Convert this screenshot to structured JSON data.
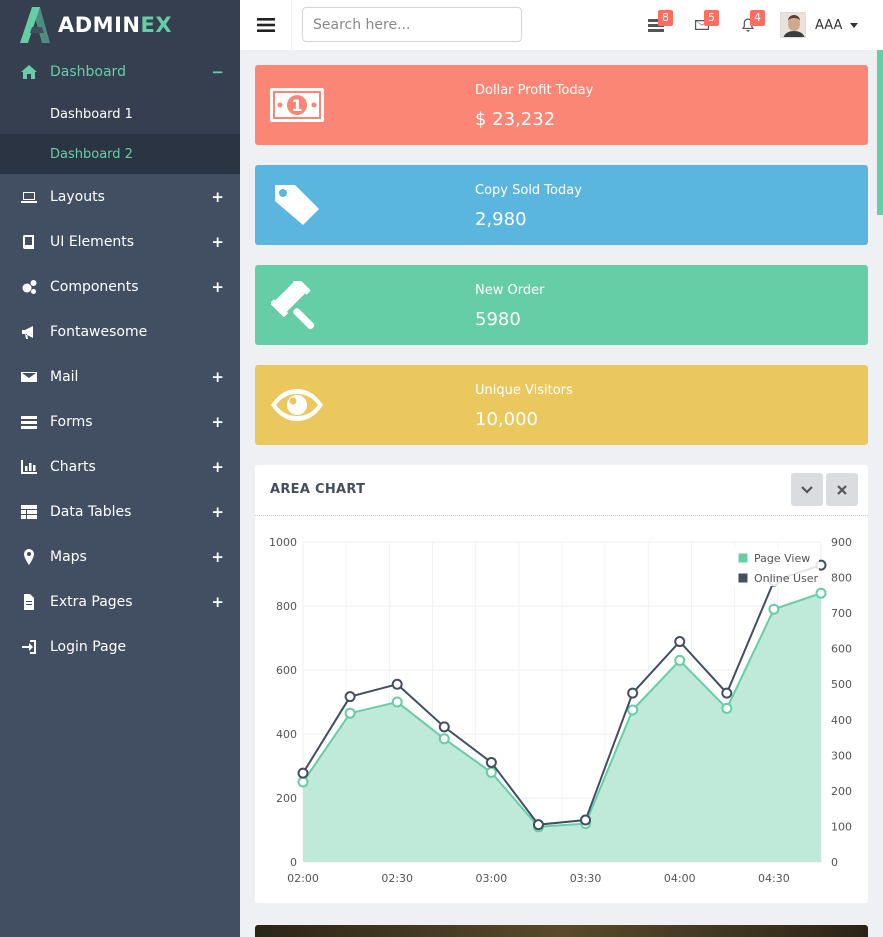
{
  "brand": {
    "text_main": "ADMIN",
    "text_accent": "EX"
  },
  "sidebar": {
    "items": [
      {
        "label": "Dashboard",
        "icon": "home-icon",
        "toggle": "−",
        "active": true,
        "children": [
          {
            "label": "Dashboard 1"
          },
          {
            "label": "Dashboard 2",
            "current": true
          }
        ]
      },
      {
        "label": "Layouts",
        "icon": "laptop-icon",
        "toggle": "+"
      },
      {
        "label": "UI Elements",
        "icon": "book-icon",
        "toggle": "+"
      },
      {
        "label": "Components",
        "icon": "cogs-icon",
        "toggle": "+"
      },
      {
        "label": "Fontawesome",
        "icon": "bullhorn-icon",
        "toggle": ""
      },
      {
        "label": "Mail",
        "icon": "envelope-icon",
        "toggle": "+"
      },
      {
        "label": "Forms",
        "icon": "tasks-icon",
        "toggle": "+"
      },
      {
        "label": "Charts",
        "icon": "bar-chart-icon",
        "toggle": "+"
      },
      {
        "label": "Data Tables",
        "icon": "table-icon",
        "toggle": "+"
      },
      {
        "label": "Maps",
        "icon": "map-marker-icon",
        "toggle": "+"
      },
      {
        "label": "Extra Pages",
        "icon": "file-icon",
        "toggle": "+"
      },
      {
        "label": "Login Page",
        "icon": "sign-in-icon",
        "toggle": ""
      }
    ]
  },
  "header": {
    "search_placeholder": "Search here...",
    "tasks_count": "8",
    "mail_count": "5",
    "notifications_count": "4",
    "user_name": "AAA"
  },
  "stats": [
    {
      "label": "Dollar Profit Today",
      "value": "$ 23,232",
      "color": "#fc8675",
      "icon": "money-icon"
    },
    {
      "label": "Copy Sold Today",
      "value": "2,980",
      "color": "#5ab6df",
      "icon": "tag-icon"
    },
    {
      "label": "New Order",
      "value": "5980",
      "color": "#65cea7",
      "icon": "gavel-icon"
    },
    {
      "label": "Unique Visitors",
      "value": "10,000",
      "color": "#ebc85e",
      "icon": "eye-icon"
    }
  ],
  "panel": {
    "title": "AREA CHART"
  },
  "chart_data": {
    "type": "line",
    "x_ticks": [
      "02:00",
      "02:30",
      "03:00",
      "03:30",
      "04:00",
      "04:30"
    ],
    "x": [
      "02:00",
      "02:15",
      "02:30",
      "02:45",
      "03:00",
      "03:15",
      "03:30",
      "03:45",
      "04:00",
      "04:15",
      "04:30",
      "04:45"
    ],
    "y_left_ticks": [
      "0",
      "200",
      "400",
      "600",
      "800",
      "1000"
    ],
    "y_right_ticks": [
      "0",
      "100",
      "200",
      "300",
      "400",
      "500",
      "600",
      "700",
      "800",
      "900"
    ],
    "ylim_left": [
      0,
      1000
    ],
    "ylim_right": [
      0,
      900
    ],
    "series": [
      {
        "name": "Page View",
        "axis": "left",
        "color": "#65cea7",
        "fill": "#bfe9d9",
        "area": true,
        "values": [
          250,
          465,
          500,
          385,
          280,
          110,
          120,
          475,
          630,
          480,
          790,
          840
        ]
      },
      {
        "name": "Online User",
        "axis": "right",
        "color": "#424f63",
        "area": false,
        "values": [
          250,
          465,
          500,
          380,
          280,
          105,
          118,
          475,
          620,
          475,
          790,
          835
        ]
      }
    ],
    "legend_position": "top-right",
    "grid": true
  }
}
